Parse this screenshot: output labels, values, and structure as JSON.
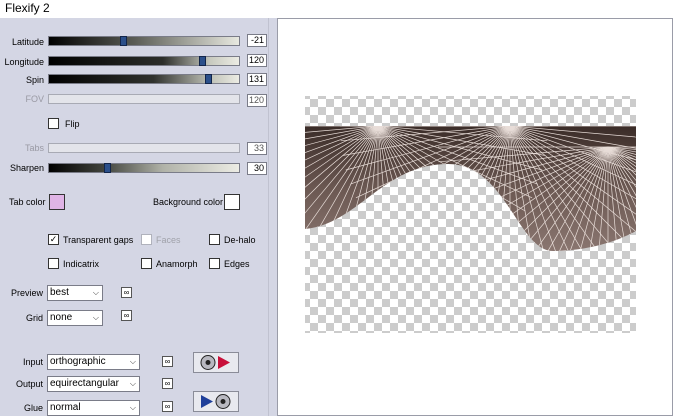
{
  "window": {
    "title": "Flexify 2"
  },
  "sliders": [
    {
      "label": "Latitude",
      "value": "-21",
      "enabled": true,
      "level": 0.39
    },
    {
      "label": "Longitude",
      "value": "120",
      "enabled": true,
      "level": 0.82
    },
    {
      "label": "Spin",
      "value": "131",
      "enabled": true,
      "level": 0.85
    },
    {
      "label": "FOV",
      "value": "120",
      "enabled": false
    }
  ],
  "flip": {
    "label": "Flip",
    "checked": false
  },
  "tabs_slider": {
    "label": "Tabs",
    "value": "33",
    "enabled": false
  },
  "sharpen_slider": {
    "label": "Sharpen",
    "value": "30",
    "enabled": true,
    "level": 0.3
  },
  "colors": {
    "tab_color_label": "Tab color",
    "tab_color": "#e0b4e6",
    "background_color_label": "Background color",
    "background_color": "#ffffff"
  },
  "checkboxes": {
    "transparent_gaps": {
      "label": "Transparent gaps",
      "checked": true
    },
    "faces": {
      "label": "Faces",
      "checked": false,
      "enabled": false
    },
    "de_halo": {
      "label": "De-halo",
      "checked": false
    },
    "indicatrix": {
      "label": "Indicatrix",
      "checked": false
    },
    "anamorph": {
      "label": "Anamorph",
      "checked": false
    },
    "edges": {
      "label": "Edges",
      "checked": false
    }
  },
  "dropdowns": {
    "preview": {
      "label": "Preview",
      "value": "best"
    },
    "grid": {
      "label": "Grid",
      "value": "none"
    },
    "input": {
      "label": "Input",
      "value": "orthographic"
    },
    "output": {
      "label": "Output",
      "value": "equirectangular"
    },
    "glue": {
      "label": "Glue",
      "value": "normal"
    }
  },
  "icons": {
    "link": "link-icon",
    "to_output": "disc-to-output-icon",
    "to_input": "arrow-to-disc-icon"
  }
}
